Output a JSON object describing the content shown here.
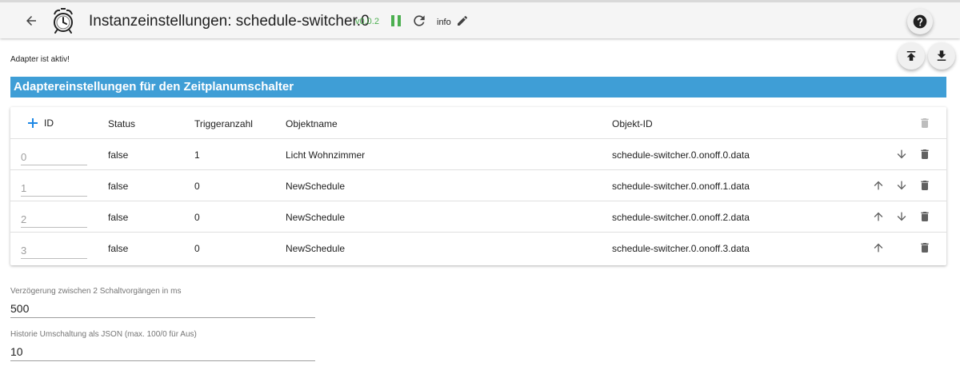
{
  "header": {
    "title": "Instanzeinstellungen: schedule-switcher.0",
    "version": "v0.0.2",
    "info_label": "info"
  },
  "status": {
    "text": "Adapter ist aktiv!"
  },
  "section": {
    "title": "Adaptereinstellungen für den Zeitplanumschalter"
  },
  "table": {
    "headers": {
      "id": "ID",
      "status": "Status",
      "triggers": "Triggeranzahl",
      "name": "Objektname",
      "object_id": "Objekt-ID"
    },
    "rows": [
      {
        "id": "0",
        "status": "false",
        "triggers": "1",
        "name": "Licht Wohnzimmer",
        "object_id": "schedule-switcher.0.onoff.0.data"
      },
      {
        "id": "1",
        "status": "false",
        "triggers": "0",
        "name": "NewSchedule",
        "object_id": "schedule-switcher.0.onoff.1.data"
      },
      {
        "id": "2",
        "status": "false",
        "triggers": "0",
        "name": "NewSchedule",
        "object_id": "schedule-switcher.0.onoff.2.data"
      },
      {
        "id": "3",
        "status": "false",
        "triggers": "0",
        "name": "NewSchedule",
        "object_id": "schedule-switcher.0.onoff.3.data"
      }
    ]
  },
  "fields": {
    "delay": {
      "label": "Verzögerung zwischen 2 Schaltvorgängen in ms",
      "value": "500"
    },
    "history": {
      "label": "Historie Umschaltung als JSON (max. 100/0 für Aus)",
      "value": "10"
    }
  },
  "colors": {
    "accent": "#3f9ed6",
    "version": "#4caf50",
    "pause": "#4caf50",
    "icon": "#616161",
    "disabled_icon": "#bdbdbd"
  },
  "icons": {
    "back": "arrow-left-icon",
    "logo": "alarm-clock-icon",
    "pause": "pause-icon",
    "reload": "reload-icon",
    "edit": "pencil-icon",
    "help": "help-icon",
    "upload": "upload-icon",
    "download": "download-icon",
    "add": "plus-icon",
    "up": "arrow-up-icon",
    "down": "arrow-down-icon",
    "delete": "trash-icon"
  }
}
